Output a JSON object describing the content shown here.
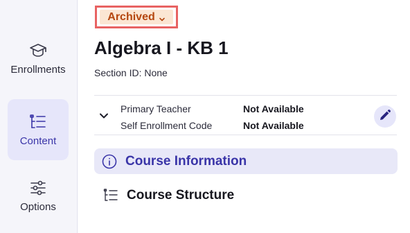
{
  "sidebar": {
    "items": [
      {
        "label": "Enrollments",
        "icon": "graduation-cap-icon",
        "active": false
      },
      {
        "label": "Content",
        "icon": "tree-list-icon",
        "active": true
      },
      {
        "label": "Options",
        "icon": "sliders-icon",
        "active": false
      }
    ]
  },
  "header": {
    "status": "Archived",
    "title": "Algebra I - KB 1",
    "section_id": "Section ID: None"
  },
  "details": {
    "rows": [
      {
        "label": "Primary Teacher",
        "value": "Not Available"
      },
      {
        "label": "Self Enrollment Code",
        "value": "Not Available"
      }
    ]
  },
  "sections": {
    "course_information": "Course Information",
    "course_structure": "Course Structure"
  },
  "colors": {
    "accent": "#3a35a8",
    "status_bg": "#fbe6d3",
    "status_text": "#b5470f",
    "highlight_border": "#e86363"
  }
}
